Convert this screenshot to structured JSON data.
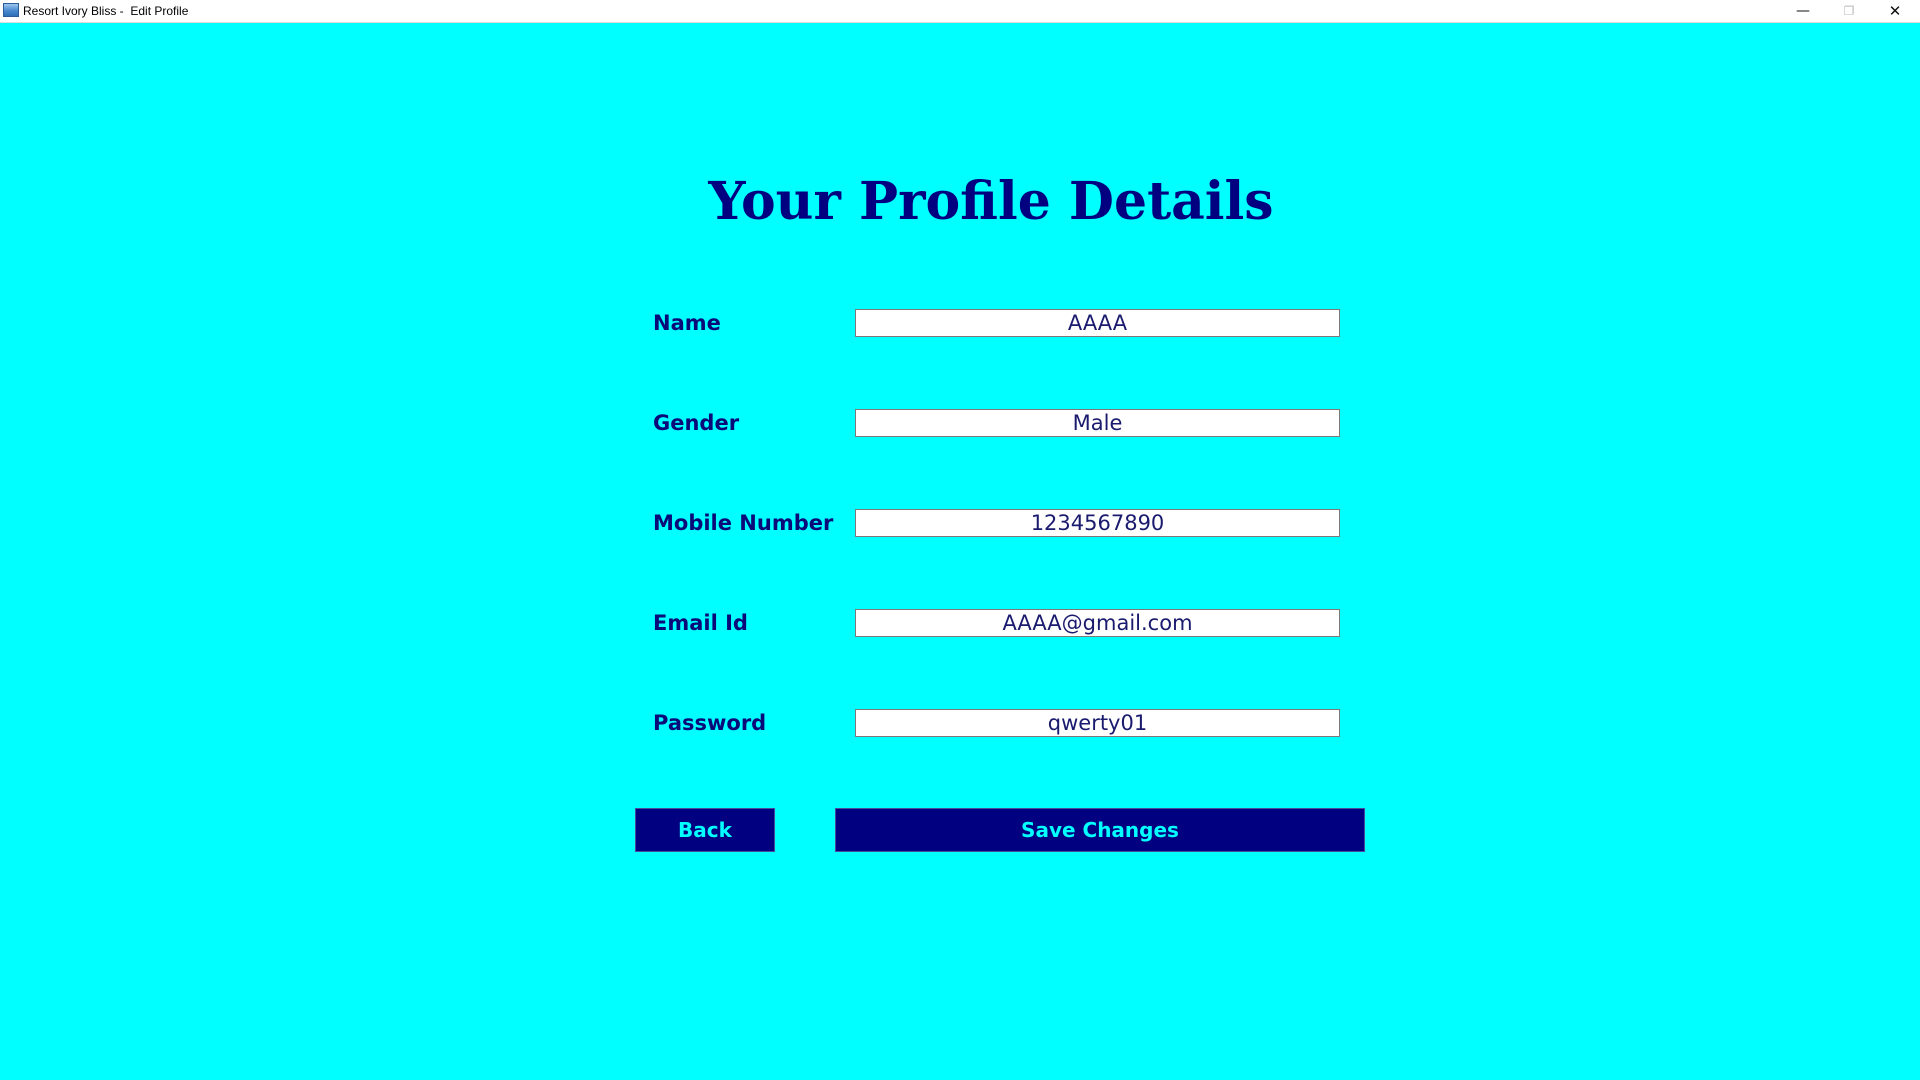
{
  "window": {
    "title": "Resort Ivory Bliss -  Edit Profile",
    "minimize_glyph": "—",
    "maximize_glyph": "❐",
    "close_glyph": "✕",
    "app_icon": "app-window-icon"
  },
  "page": {
    "heading": "Your Profile Details"
  },
  "form": {
    "name": {
      "label": "Name",
      "value": "AAAA"
    },
    "gender": {
      "label": "Gender",
      "value": "Male"
    },
    "mobile": {
      "label": "Mobile Number",
      "value": "1234567890"
    },
    "email": {
      "label": "Email Id",
      "value": "AAAA@gmail.com"
    },
    "password": {
      "label": "Password",
      "value": "qwerty01"
    }
  },
  "buttons": {
    "back_label": "Back",
    "save_label": "Save Changes"
  },
  "colors": {
    "background": "#00ffff",
    "primary": "#000080",
    "button_text": "#00ffff"
  }
}
